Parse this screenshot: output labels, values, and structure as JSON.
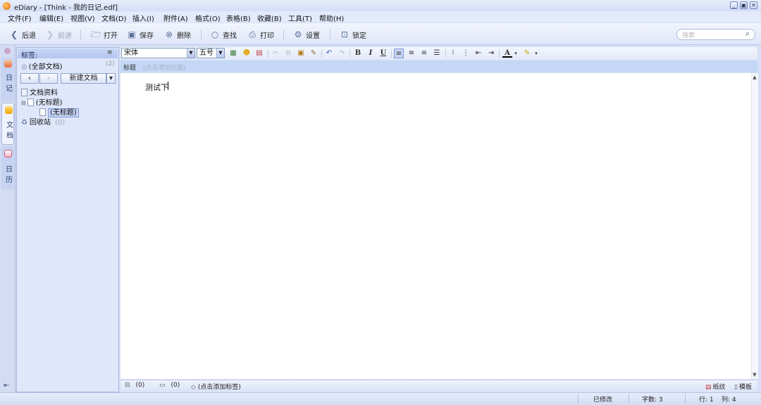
{
  "window": {
    "title": "eDiary - [Think - 我的日记.edf]",
    "controls": [
      "_",
      "▣",
      "✕"
    ]
  },
  "menu": [
    "文件(F)",
    "编辑(E)",
    "视图(V)",
    "文档(D)",
    "插入(I)",
    "附件(A)",
    "格式(O)",
    "表格(B)",
    "收藏(B)",
    "工具(T)",
    "帮助(H)"
  ],
  "toolbar": {
    "back": "后退",
    "forward": "前进",
    "open": "打开",
    "save": "保存",
    "delete": "删除",
    "find": "查找",
    "print": "打印",
    "settings": "设置",
    "lock": "锁定",
    "search_placeholder": "搜索"
  },
  "left_tabs": [
    {
      "label": "日记",
      "chars": [
        "日",
        "记"
      ],
      "icon": "diary-icon"
    },
    {
      "label": "文档",
      "chars": [
        "文",
        "档"
      ],
      "icon": "document-icon"
    },
    {
      "label": "日历",
      "chars": [
        "日",
        "历"
      ],
      "icon": "calendar-icon"
    }
  ],
  "sidebar": {
    "tags_label": "标签:",
    "all_docs": "(全部文档)",
    "all_docs_count": "(2)",
    "nav_prev": "‹",
    "nav_next": "›",
    "new_doc": "新建文档",
    "new_doc_dropdown": "▾",
    "tree": {
      "folder": "文档资料",
      "item": "(无标题)",
      "child": "(无标题)",
      "recycle": "回收站",
      "recycle_count": "(0)"
    }
  },
  "format": {
    "font": "宋体",
    "size": "五号",
    "bold": "B",
    "italic": "I",
    "underline": "U",
    "font_color": "A"
  },
  "doc": {
    "title_label": "标题",
    "title_placeholder": "(点击添加标题)",
    "content": "测试下"
  },
  "editor_bottom": {
    "attach_count": "(0)",
    "comment_count": "(0)",
    "add_tag": "(点击添加标签)",
    "paper": "纸纹",
    "template": "模板"
  },
  "status": {
    "modified": "已修改",
    "word_count": "字数: 3",
    "line": "行: 1",
    "col": "列: 4"
  },
  "colors": {
    "chrome": "#d6dff5",
    "title_row": "#c4d8f6",
    "selection": "#c8d5f5"
  }
}
